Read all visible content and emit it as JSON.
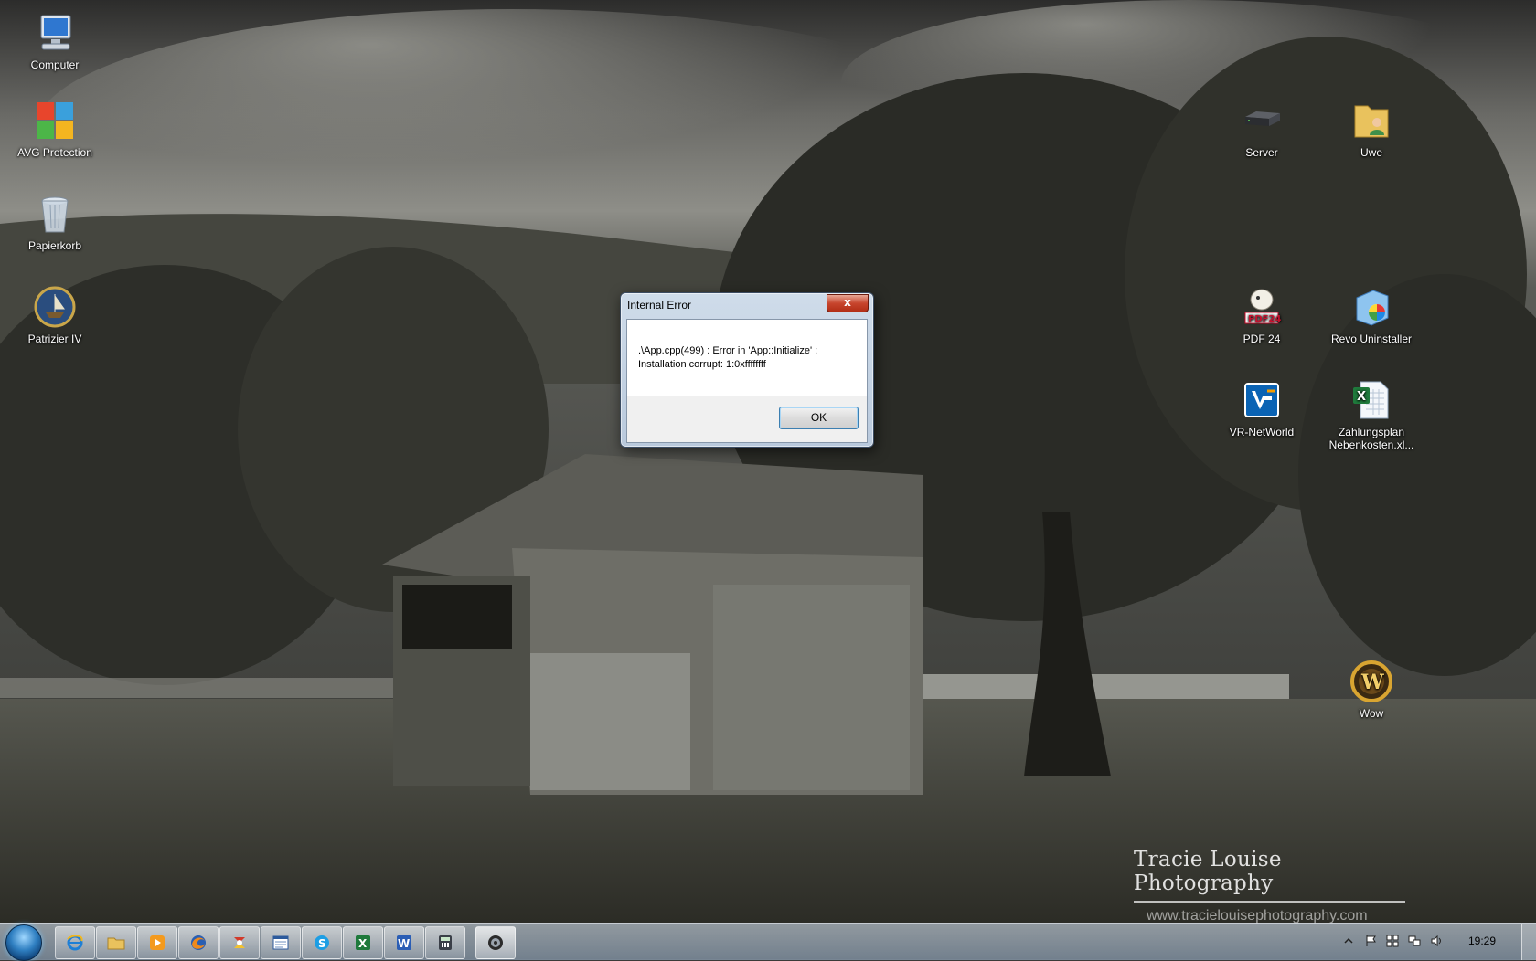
{
  "desktop": {
    "icons_left": [
      {
        "id": "computer",
        "label": "Computer",
        "icon": "computer-icon"
      },
      {
        "id": "avg",
        "label": "AVG Protection",
        "icon": "avg-icon"
      },
      {
        "id": "recycle",
        "label": "Papierkorb",
        "icon": "recycle-bin-icon"
      },
      {
        "id": "patrizier",
        "label": "Patrizier IV",
        "icon": "patrizier-icon"
      }
    ],
    "icons_right": [
      {
        "id": "server",
        "label": "Server",
        "icon": "server-icon"
      },
      {
        "id": "uwe",
        "label": "Uwe",
        "icon": "user-folder-icon"
      },
      {
        "id": "pdf24",
        "label": "PDF 24",
        "icon": "pdf24-icon"
      },
      {
        "id": "revo",
        "label": "Revo Uninstaller",
        "icon": "revo-icon"
      },
      {
        "id": "vr",
        "label": "VR-NetWorld",
        "icon": "vr-networld-icon"
      },
      {
        "id": "zahlungsplan",
        "label": "Zahlungsplan Nebenkosten.xl...",
        "icon": "excel-file-icon"
      },
      {
        "id": "wow",
        "label": "Wow",
        "icon": "wow-icon"
      }
    ]
  },
  "watermark": {
    "title": "Tracie Louise Photography",
    "url": "www.tracielouisephotography.com"
  },
  "dialog": {
    "title": "Internal Error",
    "message_line1": ".\\App.cpp(499) : Error in 'App::Initialize' :",
    "message_line2": "Installation corrupt: 1:0xffffffff",
    "ok_label": "OK",
    "close_label": "x"
  },
  "taskbar": {
    "items": [
      "internet-explorer-icon",
      "explorer-icon",
      "media-player-icon",
      "firefox-icon",
      "app-icon",
      "window-icon",
      "skype-icon",
      "excel-icon",
      "word-icon",
      "calculator-icon",
      "game-icon"
    ],
    "clock": "19:29"
  },
  "colors": {
    "dialog_close": "#c7452d",
    "taskbar": "#a9b8c8"
  }
}
